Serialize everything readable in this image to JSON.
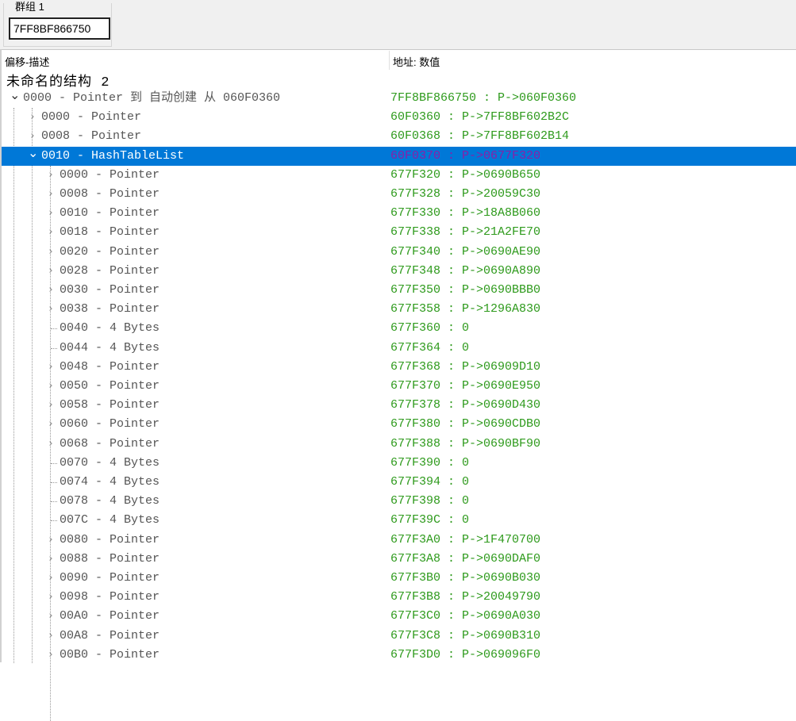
{
  "group": {
    "label": "群组 1",
    "address": "7FF8BF866750"
  },
  "header": {
    "col1": "偏移-描述",
    "col2": "地址: 数值"
  },
  "structure_name": "未命名的结构 2",
  "colors": {
    "selection": "#0078d7",
    "value": "#2e9a1c",
    "selected_value": "#8b1fa8"
  },
  "rows": [
    {
      "level": 0,
      "kind": "expanded",
      "desc": "0000 - Pointer 到 自动创建 从 060F0360",
      "value": "7FF8BF866750 : P->060F0360"
    },
    {
      "level": 1,
      "kind": "collapsed",
      "desc": "0000 - Pointer",
      "value": "60F0360 : P->7FF8BF602B2C"
    },
    {
      "level": 1,
      "kind": "collapsed",
      "desc": "0008 - Pointer",
      "value": "60F0368 : P->7FF8BF602B14"
    },
    {
      "level": 1,
      "kind": "expanded",
      "selected": true,
      "desc": "0010 - HashTableList",
      "value": "60F0370 : P->0677F320"
    },
    {
      "level": 2,
      "kind": "collapsed",
      "desc": "0000 - Pointer",
      "value": "677F320 : P->0690B650"
    },
    {
      "level": 2,
      "kind": "collapsed",
      "desc": "0008 - Pointer",
      "value": "677F328 : P->20059C30"
    },
    {
      "level": 2,
      "kind": "collapsed",
      "desc": "0010 - Pointer",
      "value": "677F330 : P->18A8B060"
    },
    {
      "level": 2,
      "kind": "collapsed",
      "desc": "0018 - Pointer",
      "value": "677F338 : P->21A2FE70"
    },
    {
      "level": 2,
      "kind": "collapsed",
      "desc": "0020 - Pointer",
      "value": "677F340 : P->0690AE90"
    },
    {
      "level": 2,
      "kind": "collapsed",
      "desc": "0028 - Pointer",
      "value": "677F348 : P->0690A890"
    },
    {
      "level": 2,
      "kind": "collapsed",
      "desc": "0030 - Pointer",
      "value": "677F350 : P->0690BBB0"
    },
    {
      "level": 2,
      "kind": "collapsed",
      "desc": "0038 - Pointer",
      "value": "677F358 : P->1296A830"
    },
    {
      "level": 2,
      "kind": "leaf",
      "desc": "0040 - 4 Bytes",
      "value": "677F360 : 0"
    },
    {
      "level": 2,
      "kind": "leaf",
      "desc": "0044 - 4 Bytes",
      "value": "677F364 : 0"
    },
    {
      "level": 2,
      "kind": "collapsed",
      "desc": "0048 - Pointer",
      "value": "677F368 : P->06909D10"
    },
    {
      "level": 2,
      "kind": "collapsed",
      "desc": "0050 - Pointer",
      "value": "677F370 : P->0690E950"
    },
    {
      "level": 2,
      "kind": "collapsed",
      "desc": "0058 - Pointer",
      "value": "677F378 : P->0690D430"
    },
    {
      "level": 2,
      "kind": "collapsed",
      "desc": "0060 - Pointer",
      "value": "677F380 : P->0690CDB0"
    },
    {
      "level": 2,
      "kind": "collapsed",
      "desc": "0068 - Pointer",
      "value": "677F388 : P->0690BF90"
    },
    {
      "level": 2,
      "kind": "leaf",
      "desc": "0070 - 4 Bytes",
      "value": "677F390 : 0"
    },
    {
      "level": 2,
      "kind": "leaf",
      "desc": "0074 - 4 Bytes",
      "value": "677F394 : 0"
    },
    {
      "level": 2,
      "kind": "leaf",
      "desc": "0078 - 4 Bytes",
      "value": "677F398 : 0"
    },
    {
      "level": 2,
      "kind": "leaf",
      "desc": "007C - 4 Bytes",
      "value": "677F39C : 0"
    },
    {
      "level": 2,
      "kind": "collapsed",
      "desc": "0080 - Pointer",
      "value": "677F3A0 : P->1F470700"
    },
    {
      "level": 2,
      "kind": "collapsed",
      "desc": "0088 - Pointer",
      "value": "677F3A8 : P->0690DAF0"
    },
    {
      "level": 2,
      "kind": "collapsed",
      "desc": "0090 - Pointer",
      "value": "677F3B0 : P->0690B030"
    },
    {
      "level": 2,
      "kind": "collapsed",
      "desc": "0098 - Pointer",
      "value": "677F3B8 : P->20049790"
    },
    {
      "level": 2,
      "kind": "collapsed",
      "desc": "00A0 - Pointer",
      "value": "677F3C0 : P->0690A030"
    },
    {
      "level": 2,
      "kind": "collapsed",
      "desc": "00A8 - Pointer",
      "value": "677F3C8 : P->0690B310"
    },
    {
      "level": 2,
      "kind": "collapsed",
      "desc": "00B0 - Pointer",
      "value": "677F3D0 : P->069096F0"
    }
  ]
}
